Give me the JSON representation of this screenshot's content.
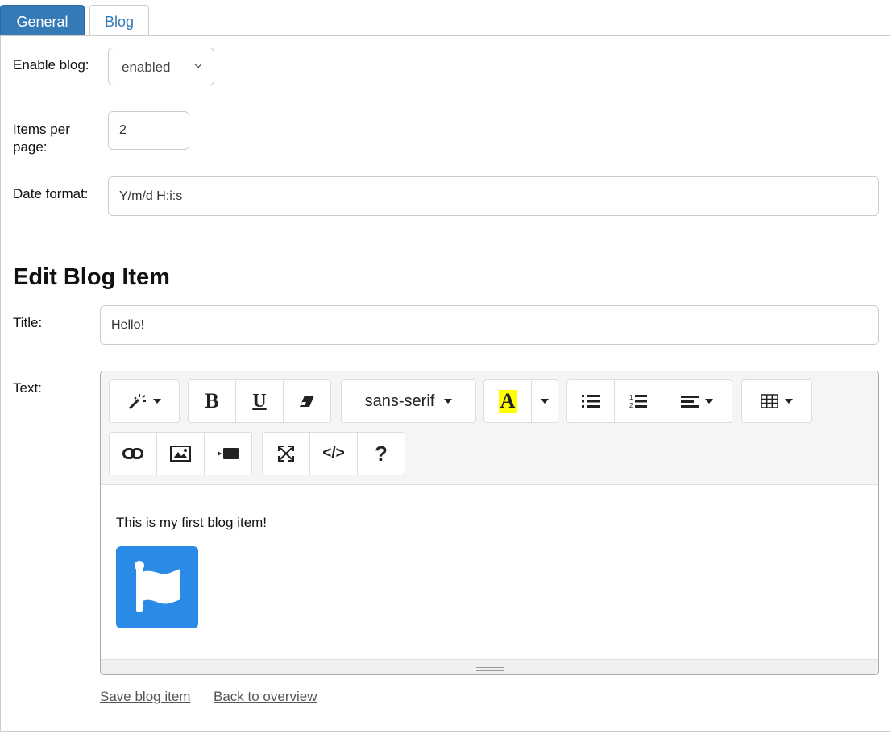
{
  "tabs": [
    {
      "label": "General",
      "active": true
    },
    {
      "label": "Blog",
      "active": false
    }
  ],
  "settings": {
    "enable_blog_label": "Enable blog:",
    "enable_blog_value": "enabled",
    "items_per_page_label_line1": "Items per",
    "items_per_page_label_line2": "page:",
    "items_per_page_value": "2",
    "date_format_label": "Date format:",
    "date_format_value": "Y/m/d H:i:s"
  },
  "edit": {
    "heading": "Edit Blog Item",
    "title_label": "Title:",
    "title_value": "Hello!",
    "text_label": "Text:"
  },
  "editor": {
    "font_name": "sans-serif",
    "content_text": "This is my first blog item!",
    "icons": [
      "magic-icon",
      "bold-icon",
      "underline-icon",
      "eraser-icon",
      "font-color-icon",
      "unordered-list-icon",
      "ordered-list-icon",
      "align-icon",
      "table-icon",
      "link-icon",
      "picture-icon",
      "video-icon",
      "fullscreen-icon",
      "code-view-icon",
      "help-icon"
    ]
  },
  "colors": {
    "accent": "#337ab7",
    "font_color_highlight": "#ffff00",
    "image_blue": "#2a8be7"
  },
  "actions": {
    "save_label": "Save blog item",
    "back_label": "Back to overview"
  }
}
